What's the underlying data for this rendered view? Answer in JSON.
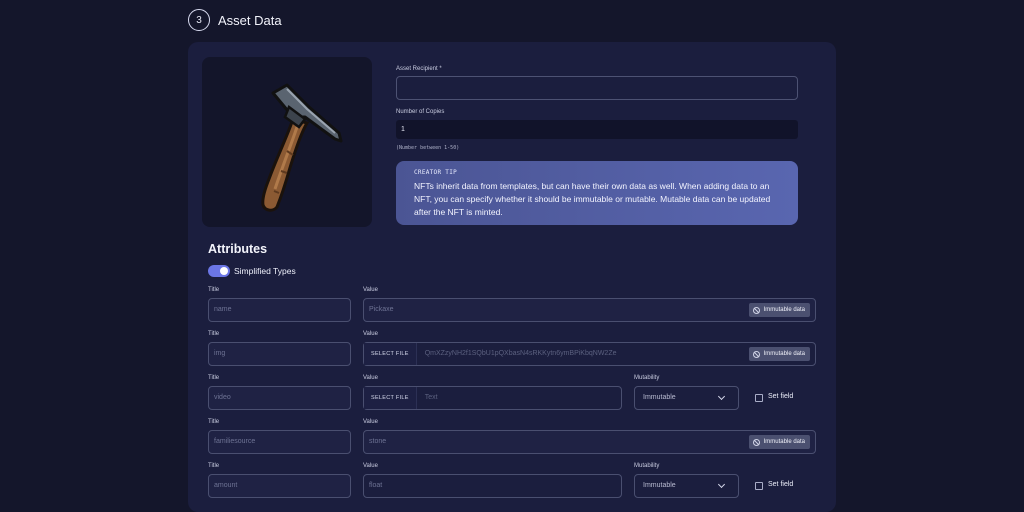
{
  "step": {
    "number": "3",
    "title": "Asset Data"
  },
  "form": {
    "recipient_label": "Asset Recipient *",
    "recipient_value": "",
    "copies_label": "Number of Copies",
    "copies_value": "1",
    "copies_hint": "(Number between 1-50)"
  },
  "tip": {
    "title": "CREATOR TIP",
    "text": "NFTs inherit data from templates, but can have their own data as well. When adding data to an NFT, you can specify whether it should be immutable or mutable. Mutable data can be updated after the NFT is minted."
  },
  "attributes": {
    "heading": "Attributes",
    "toggle_label": "Simplified Types",
    "toggle_on": true,
    "col_title": "Title",
    "col_value": "Value",
    "col_mutability": "Mutability",
    "badge_label": "Immutable data",
    "select_file_label": "SELECT FILE",
    "set_field_label": "Set field",
    "rows": [
      {
        "title": "name",
        "value": "Pickaxe"
      },
      {
        "title": "img",
        "value": "QmXZzyNH2f1SQbU1pQXbasN4sRKKytn6ymBPiKbqNW2Ze"
      },
      {
        "title": "video",
        "value": "Text",
        "mutability": "Immutable"
      },
      {
        "title": "familiesource",
        "value": "stone"
      },
      {
        "title": "amount",
        "value": "float",
        "mutability": "Immutable"
      }
    ]
  },
  "colors": {
    "background": "#14162b",
    "card": "#1b1e3e",
    "accent": "#6b76e6",
    "tip_gradient_start": "#4b5594",
    "tip_gradient_end": "#5966b0"
  }
}
